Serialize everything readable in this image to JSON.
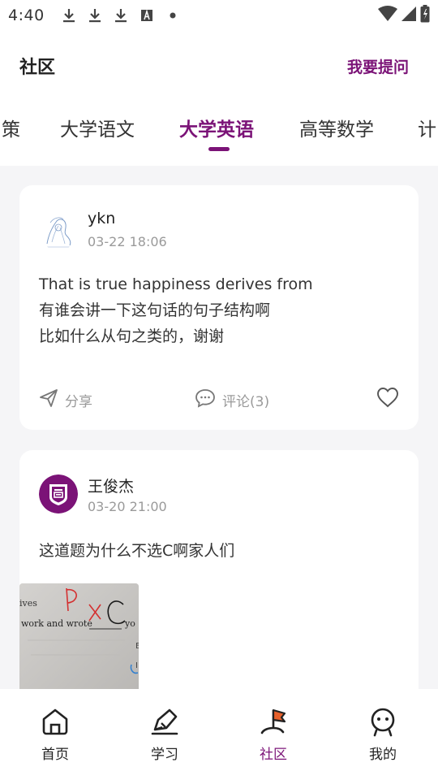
{
  "status_bar": {
    "time": "4:40",
    "icons": [
      "download-icon",
      "download-icon",
      "download-icon",
      "font-a-icon",
      "dot-icon"
    ],
    "right_icons": [
      "wifi-icon",
      "signal-icon",
      "battery-icon"
    ]
  },
  "header": {
    "title": "社区",
    "ask_button": "我要提问",
    "accent_color": "#7b1377"
  },
  "tabs": [
    {
      "label": "策"
    },
    {
      "label": "大学语文"
    },
    {
      "label": "大学英语",
      "active": true
    },
    {
      "label": "高等数学"
    },
    {
      "label": "计"
    }
  ],
  "posts": [
    {
      "username": "ykn",
      "time": "03-22 18:06",
      "body": "That is true happiness derives from\n有谁会讲一下这句话的句子结构啊\n比如什么从句之类的，谢谢",
      "share_label": "分享",
      "comment_label": "评论(3)",
      "liked": false
    },
    {
      "username": "王俊杰",
      "time": "03-20 21:00",
      "body": "这道题为什么不选C啊家人们",
      "image_text": {
        "line1": "ives",
        "line2": "work and wrote",
        "line3": "yo"
      }
    }
  ],
  "bottom_nav": [
    {
      "label": "首页",
      "icon": "home-icon"
    },
    {
      "label": "学习",
      "icon": "pen-icon"
    },
    {
      "label": "社区",
      "icon": "community-flag-icon",
      "active": true
    },
    {
      "label": "我的",
      "icon": "profile-face-icon"
    }
  ]
}
